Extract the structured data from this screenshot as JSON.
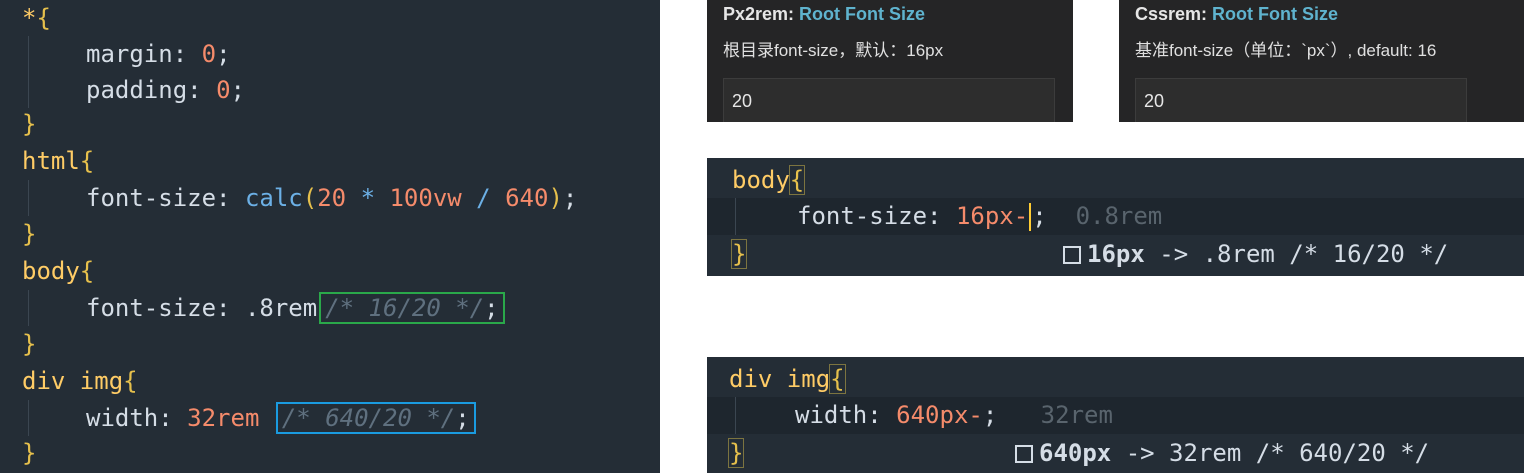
{
  "left_editor": {
    "lines": {
      "l1_sel": "*",
      "l1_brace": "{",
      "l2_prop": "margin",
      "l2_val": "0",
      "l3_prop": "padding",
      "l3_val": "0",
      "l4": "}",
      "l5_sel": "html",
      "l5_brace": "{",
      "l6_prop": "font-size",
      "l6_fn": "calc",
      "l6_a": "20",
      "l6_op1": "*",
      "l6_b": "100vw",
      "l6_op2": "/",
      "l6_c": "640",
      "l7": "}",
      "l8_sel": "body",
      "l8_brace": "{",
      "l9_prop": "font-size",
      "l9_val": ".8rem",
      "l9_comment": "/* 16/20 */",
      "l10": "}",
      "l11_sel": "div img",
      "l11_brace": "{",
      "l12_prop": "width",
      "l12_val": "32rem",
      "l12_comment": "/* 640/20 */",
      "l13": "}"
    },
    "highlight_colors": {
      "green": "#2aa84a",
      "blue": "#1a9be0"
    }
  },
  "px2rem_panel": {
    "title_prefix": "Px2rem: ",
    "title_rest": "Root Font Size",
    "description": "根目录font-size，默认：16px",
    "value": "20"
  },
  "cssrem_panel": {
    "title_prefix": "Cssrem: ",
    "title_rest": "Root Font Size",
    "description": "基准font-size（单位：`px`）, default: 16",
    "value": "20"
  },
  "snippet_body": {
    "selector": "body",
    "open_brace": "{",
    "prop": "font-size",
    "typed_value": "16px-",
    "semicolon": ";",
    "ghost_text": "0.8rem",
    "close_brace": "}",
    "suggestion_bold": "16px",
    "suggestion_rest": " -> .8rem /* 16/20 */"
  },
  "snippet_div": {
    "selector": "div img",
    "open_brace": "{",
    "prop": "width",
    "typed_value": "640px-",
    "semicolon": ";",
    "ghost_text": "32rem",
    "close_brace": "}",
    "suggestion_bold": "640px",
    "suggestion_rest": " -> 32rem /* 640/20 */"
  }
}
